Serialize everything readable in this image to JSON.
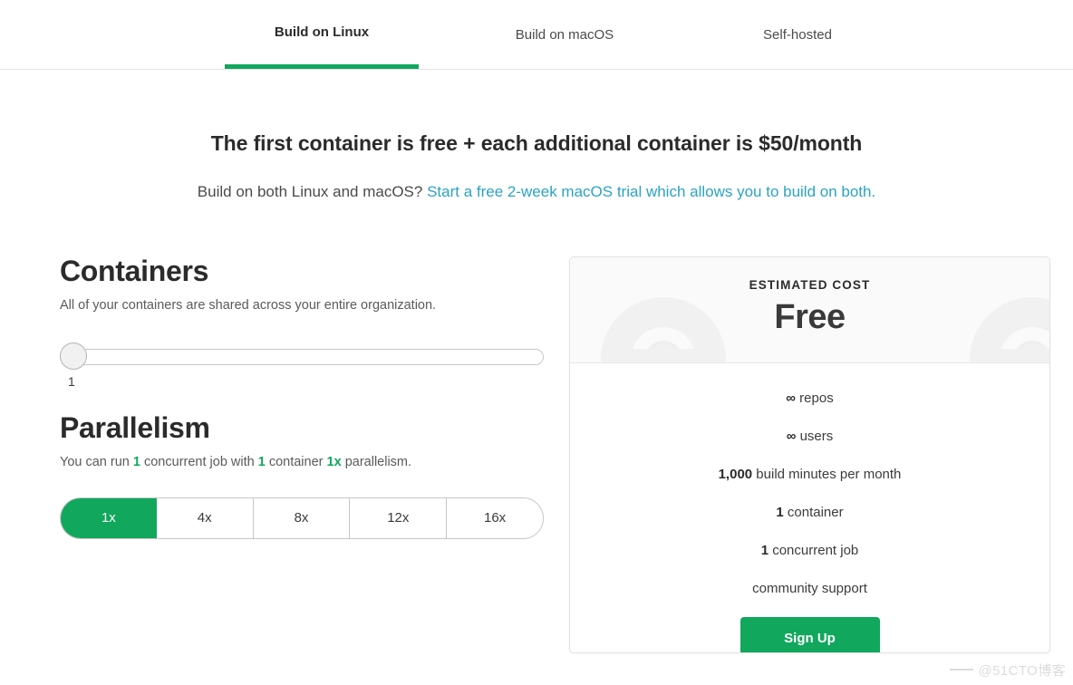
{
  "tabs": [
    {
      "label": "Build on Linux",
      "active": true
    },
    {
      "label": "Build on macOS",
      "active": false
    },
    {
      "label": "Self-hosted",
      "active": false
    }
  ],
  "headline": "The first container is free + each additional container is $50/month",
  "subline": {
    "prefix": "Build on both Linux and macOS? ",
    "link": "Start a free 2-week macOS trial which allows you to build on both."
  },
  "containers": {
    "title": "Containers",
    "description": "All of your containers are shared across your entire organization.",
    "slider": {
      "value": "1",
      "min": 1,
      "max": 80,
      "position_percent": 0
    }
  },
  "parallelism": {
    "title": "Parallelism",
    "desc_prefix": "You can run ",
    "desc_jobs": "1",
    "desc_mid1": " concurrent job with ",
    "desc_containers": "1",
    "desc_mid2": " container ",
    "desc_parallelism": "1x",
    "desc_suffix": " parallelism.",
    "options": [
      {
        "label": "1x",
        "active": true
      },
      {
        "label": "4x",
        "active": false
      },
      {
        "label": "8x",
        "active": false
      },
      {
        "label": "12x",
        "active": false
      },
      {
        "label": "16x",
        "active": false
      }
    ]
  },
  "cost_card": {
    "label": "ESTIMATED COST",
    "price": "Free",
    "features": [
      {
        "strong": "∞",
        "text": " repos"
      },
      {
        "strong": "∞",
        "text": " users"
      },
      {
        "strong": "1,000",
        "text": " build minutes per month"
      },
      {
        "strong": "1",
        "text": " container"
      },
      {
        "strong": "1",
        "text": " concurrent job"
      },
      {
        "strong": "",
        "text": "community support"
      }
    ],
    "cta": "Sign Up"
  },
  "watermark": "@51CTO博客",
  "colors": {
    "brand_green": "#11a75c",
    "link_blue": "#2ba3c4",
    "text_dark": "#2b2b2b",
    "border_grey": "#c6c6c6",
    "card_head_bg": "#fafafa"
  }
}
